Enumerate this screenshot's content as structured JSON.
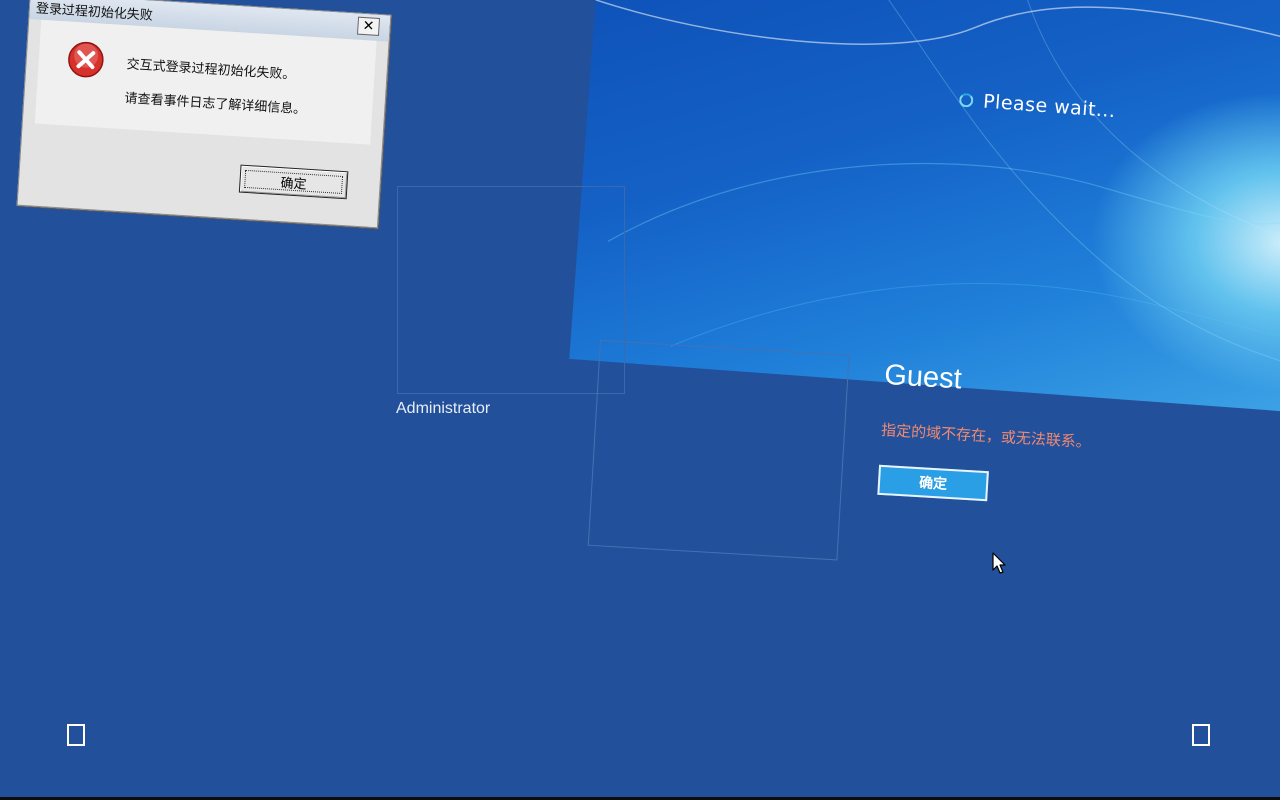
{
  "wallpaper": {
    "status_text": "Please wait..."
  },
  "users": {
    "admin": {
      "name": "Administrator"
    },
    "guest": {
      "name": "Guest",
      "error_message": "指定的域不存在，或无法联系。",
      "ok_label": "确定"
    }
  },
  "dialog": {
    "title": "登录过程初始化失败",
    "close_label": "✕",
    "message_line1": "交互式登录过程初始化失败。",
    "message_line2": "请查看事件日志了解详细信息。",
    "ok_label": "确定"
  },
  "colors": {
    "background": "#23509a",
    "error_text": "#f08a72",
    "ok_button": "#2a9fe6"
  },
  "icons": {
    "dialog_icon": "error-icon",
    "corner_left": "box-glyph-icon",
    "corner_right": "box-glyph-icon",
    "pointer": "mouse-cursor-icon"
  }
}
